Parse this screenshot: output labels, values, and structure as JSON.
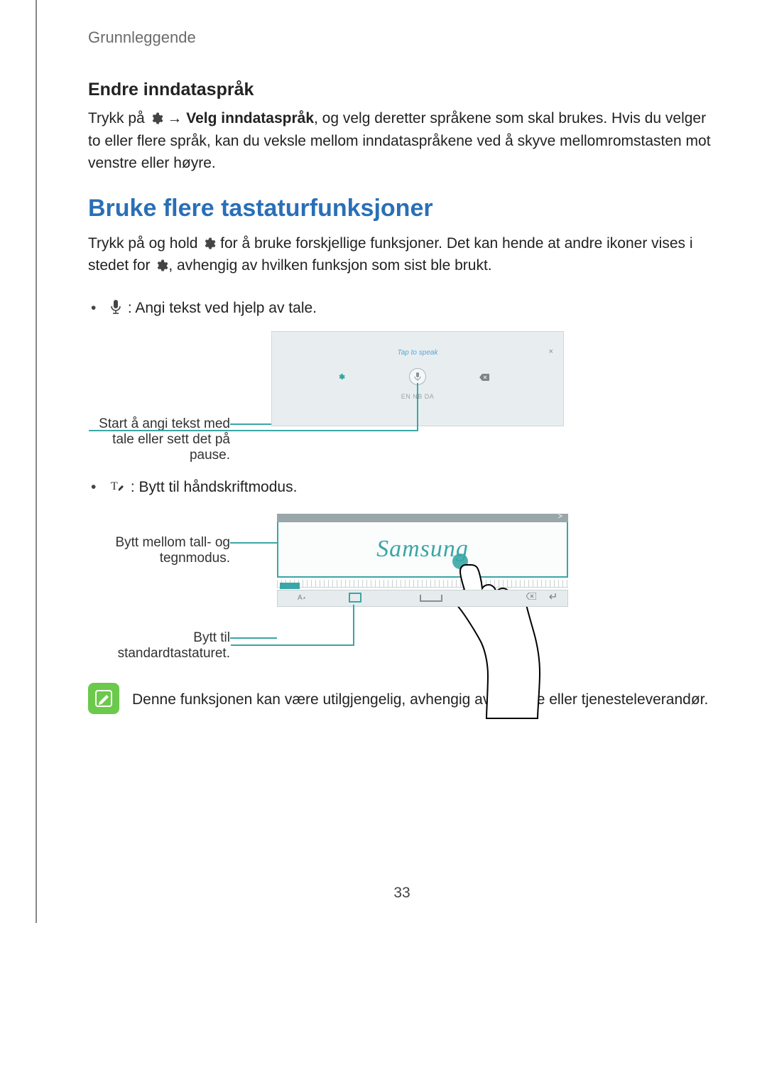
{
  "breadcrumb": "Grunnleggende",
  "section1": {
    "heading": "Endre inndataspråk",
    "p_before": "Trykk på ",
    "arrow": "→",
    "bold": "Velg inndataspråk",
    "p_after": ", og velg deretter språkene som skal brukes. Hvis du velger to eller flere språk, kan du veksle mellom inndataspråkene ved å skyve mellomromstasten mot venstre eller høyre."
  },
  "section2": {
    "heading": "Bruke flere tastaturfunksjoner",
    "p1_before": "Trykk på og hold ",
    "p1_mid": " for å bruke forskjellige funksjoner. Det kan hende at andre ikoner vises i stedet for ",
    "p1_after": ", avhengig av hvilken funksjon som sist ble brukt."
  },
  "bullet1": ": Angi tekst ved hjelp av tale.",
  "fig1": {
    "callout": "Start å angi tekst med tale eller sett det på pause.",
    "tap": "Tap to speak",
    "lang": "EN   NB   DA"
  },
  "bullet2": ": Bytt til håndskriftmodus.",
  "fig2": {
    "callout1": "Bytt mellom tall- og tegnmodus.",
    "callout2": "Bytt til standardtastaturet.",
    "written": "Samsung"
  },
  "note": "Denne funksjonen kan være utilgjengelig, avhengig av område eller tjenesteleverandør.",
  "page_number": "33"
}
